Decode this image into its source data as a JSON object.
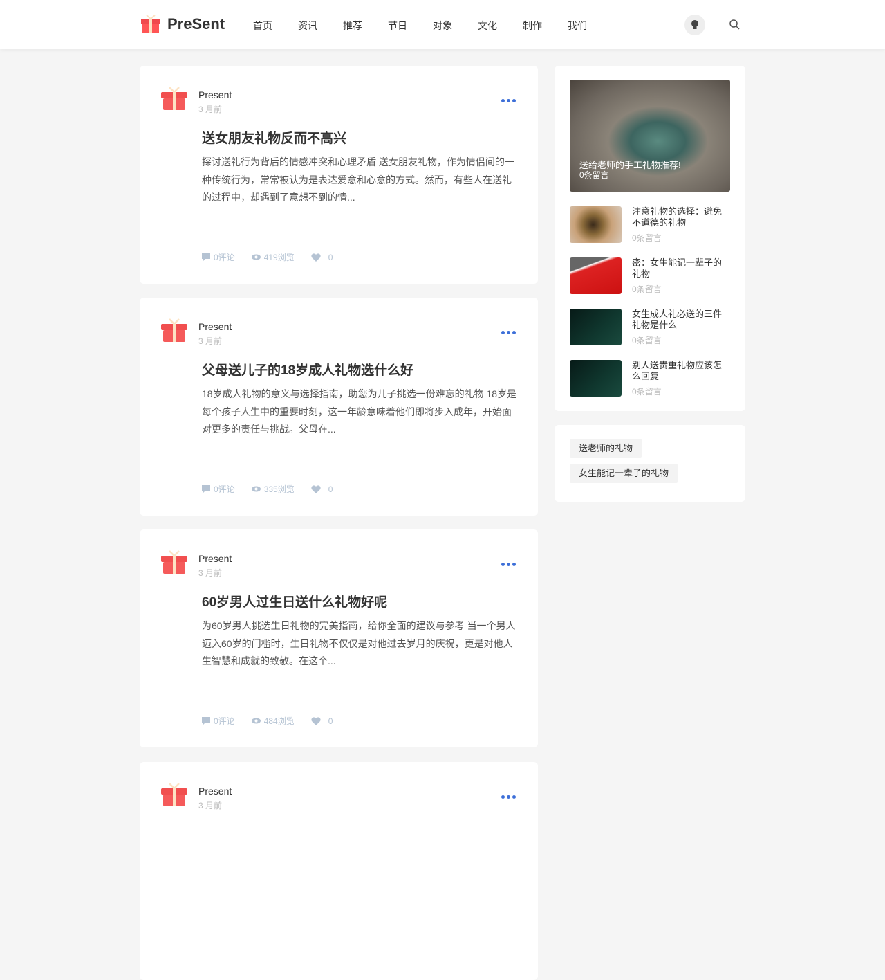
{
  "header": {
    "logo": "PreSent",
    "nav": [
      "首页",
      "资讯",
      "推荐",
      "节日",
      "对象",
      "文化",
      "制作",
      "我们"
    ]
  },
  "posts": [
    {
      "author": "Present",
      "time": "3 月前",
      "title": "送女朋友礼物反而不高兴",
      "excerpt": "探讨送礼行为背后的情感冲突和心理矛盾 送女朋友礼物，作为情侣间的一种传统行为，常常被认为是表达爱意和心意的方式。然而，有些人在送礼的过程中，却遇到了意想不到的情...",
      "comments": "0评论",
      "views": "419浏览",
      "likes": "0"
    },
    {
      "author": "Present",
      "time": "3 月前",
      "title": "父母送儿子的18岁成人礼物选什么好",
      "excerpt": "18岁成人礼物的意义与选择指南，助您为儿子挑选一份难忘的礼物 18岁是每个孩子人生中的重要时刻，这一年龄意味着他们即将步入成年，开始面对更多的责任与挑战。父母在...",
      "comments": "0评论",
      "views": "335浏览",
      "likes": "0"
    },
    {
      "author": "Present",
      "time": "3 月前",
      "title": "60岁男人过生日送什么礼物好呢",
      "excerpt": "为60岁男人挑选生日礼物的完美指南，给你全面的建议与参考 当一个男人迈入60岁的门槛时，生日礼物不仅仅是对他过去岁月的庆祝，更是对他人生智慧和成就的致敬。在这个...",
      "comments": "0评论",
      "views": "484浏览",
      "likes": "0"
    },
    {
      "author": "Present",
      "time": "3 月前"
    }
  ],
  "sidebar": {
    "featured": {
      "title": "送给老师的手工礼物推荐!",
      "count": "0条留言"
    },
    "items": [
      {
        "title": "注意礼物的选择：避免不道德的礼物",
        "count": "0条留言"
      },
      {
        "title": "密：女生能记一辈子的礼物",
        "count": "0条留言"
      },
      {
        "title": "女生成人礼必送的三件礼物是什么",
        "count": "0条留言"
      },
      {
        "title": "别人送贵重礼物应该怎么回复",
        "count": "0条留言"
      }
    ],
    "tags": [
      "送老师的礼物",
      "女生能记一辈子的礼物"
    ]
  }
}
